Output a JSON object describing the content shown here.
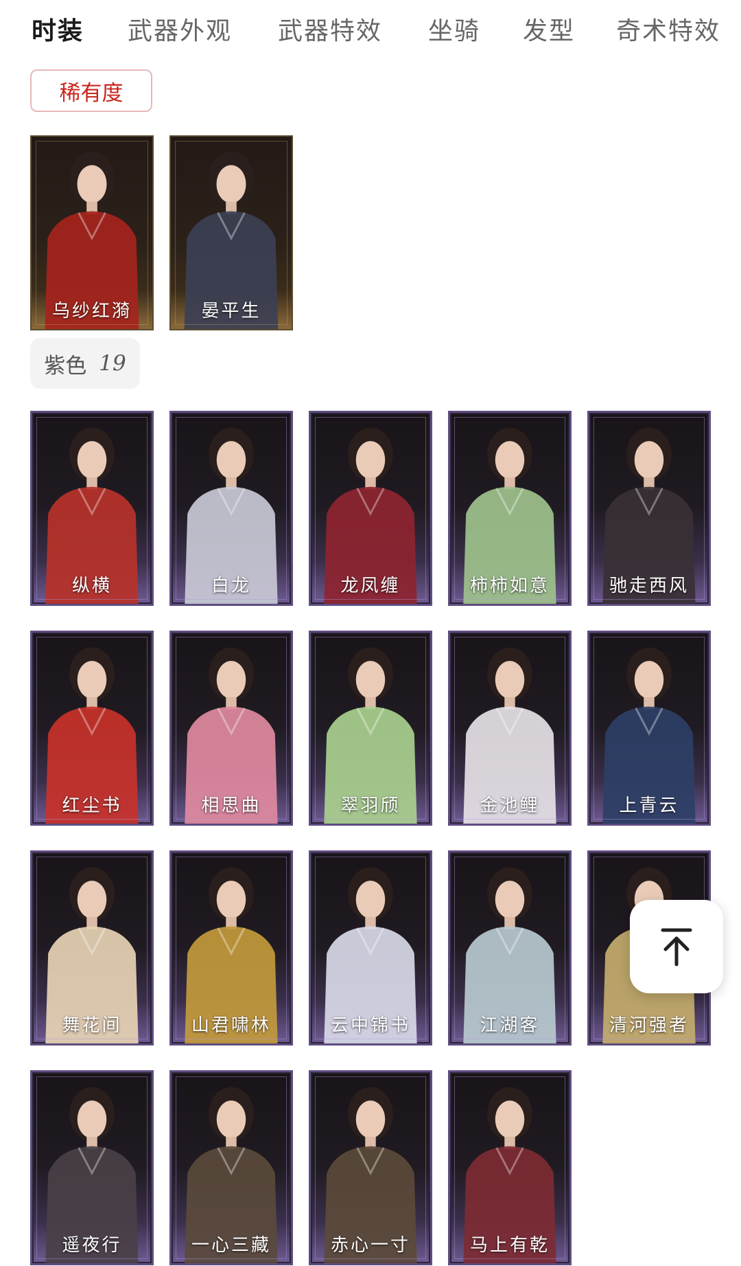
{
  "tabs": [
    {
      "label": "时装",
      "active": true
    },
    {
      "label": "武器外观",
      "active": false
    },
    {
      "label": "武器特效",
      "active": false
    },
    {
      "label": "坐骑",
      "active": false
    },
    {
      "label": "发型",
      "active": false
    },
    {
      "label": "奇术特效",
      "active": false
    }
  ],
  "rare_section": {
    "chip_label": "稀有度",
    "items": [
      "乌纱红漪",
      "晏平生"
    ]
  },
  "purple_section": {
    "chip_label": "紫色",
    "count": "19",
    "items": [
      "纵横",
      "白龙",
      "龙凤缠",
      "柿柿如意",
      "驰走西风",
      "红尘书",
      "相思曲",
      "翠羽颀",
      "金池鲤",
      "上青云",
      "舞花间",
      "山君啸林",
      "云中锦书",
      "江湖客",
      "清河强者",
      "遥夜行",
      "一心三藏",
      "赤心一寸",
      "马上有乾"
    ]
  },
  "back_to_top": {
    "icon": "arrow-up-to-line-icon"
  },
  "colors": {
    "rare_accent": "#c9261e",
    "purple_frame": "#5e4d80",
    "text_active": "#1a1a1a",
    "text_inactive": "#666666"
  }
}
